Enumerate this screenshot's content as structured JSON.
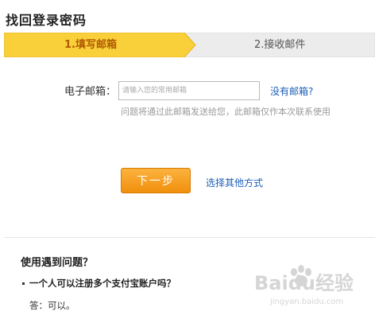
{
  "page": {
    "title": "找回登录密码"
  },
  "steps": [
    {
      "label": "1.填写邮箱",
      "active": true
    },
    {
      "label": "2.接收邮件",
      "active": false
    }
  ],
  "colors": {
    "active_step": "#f9d03a",
    "inactive_step": "#ececec",
    "link": "#1b5eb8",
    "button": "#f39a1a"
  },
  "form": {
    "email_label": "电子邮箱：",
    "email_placeholder": "请输入您的常用邮箱",
    "email_value": "",
    "no_email_link": "没有邮箱?",
    "hint": "问题将通过此邮箱发送给您，此邮箱仅作本次联系使用"
  },
  "actions": {
    "next_label": "下一步",
    "other_method_label": "选择其他方式"
  },
  "faq": {
    "title": "使用遇到问题？",
    "question": "一个人可以注册多个支付宝账户吗？",
    "answer": "答：可以。"
  },
  "watermark": {
    "logo_text": "Baidu经验",
    "url_text": "jingyan.baidu.com"
  }
}
